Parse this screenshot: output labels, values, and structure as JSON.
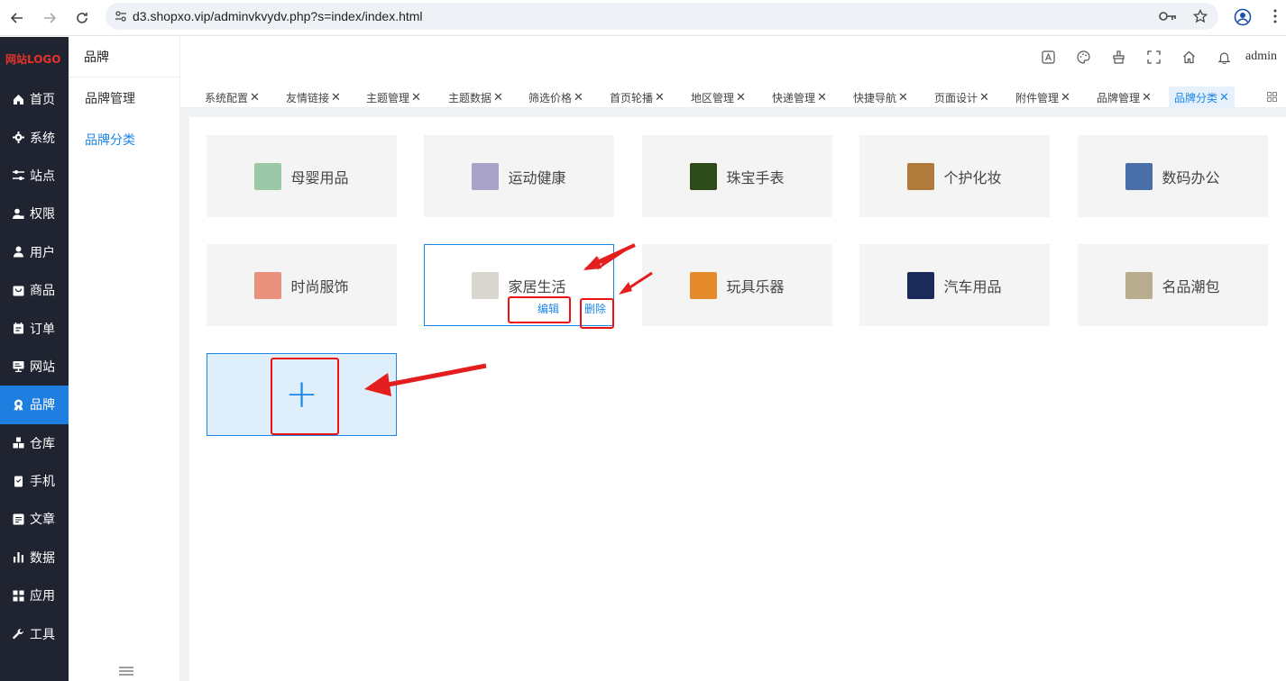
{
  "browser": {
    "url": "d3.shopxo.vip/adminvkvydv.php?s=index/index.html"
  },
  "sidebar": {
    "logo": "网站LOGO",
    "items": [
      {
        "label": "首页",
        "icon": "home-icon"
      },
      {
        "label": "系统",
        "icon": "gear-icon"
      },
      {
        "label": "站点",
        "icon": "sliders-icon"
      },
      {
        "label": "权限",
        "icon": "user-lock-icon"
      },
      {
        "label": "用户",
        "icon": "users-icon"
      },
      {
        "label": "商品",
        "icon": "bag-icon"
      },
      {
        "label": "订单",
        "icon": "order-icon"
      },
      {
        "label": "网站",
        "icon": "monitor-icon"
      },
      {
        "label": "品牌",
        "icon": "brand-icon",
        "active": true
      },
      {
        "label": "仓库",
        "icon": "warehouse-icon"
      },
      {
        "label": "手机",
        "icon": "phone-icon"
      },
      {
        "label": "文章",
        "icon": "article-icon"
      },
      {
        "label": "数据",
        "icon": "chart-icon"
      },
      {
        "label": "应用",
        "icon": "apps-icon"
      },
      {
        "label": "工具",
        "icon": "wrench-icon"
      }
    ]
  },
  "subnav": {
    "title": "品牌",
    "items": [
      {
        "label": "品牌管理"
      },
      {
        "label": "品牌分类",
        "active": true
      }
    ]
  },
  "header": {
    "user": "admin"
  },
  "tabs": [
    {
      "label": "系统配置"
    },
    {
      "label": "友情链接"
    },
    {
      "label": "主题管理"
    },
    {
      "label": "主题数据"
    },
    {
      "label": "筛选价格"
    },
    {
      "label": "首页轮播"
    },
    {
      "label": "地区管理"
    },
    {
      "label": "快递管理"
    },
    {
      "label": "快捷导航"
    },
    {
      "label": "页面设计"
    },
    {
      "label": "附件管理"
    },
    {
      "label": "品牌管理"
    },
    {
      "label": "品牌分类",
      "active": true
    }
  ],
  "categories": [
    {
      "label": "母婴用品",
      "color": "#9cc7a8"
    },
    {
      "label": "运动健康",
      "color": "#a9a3c9"
    },
    {
      "label": "珠宝手表",
      "color": "#2d4a1a"
    },
    {
      "label": "个护化妆",
      "color": "#b07a3a"
    },
    {
      "label": "数码办公",
      "color": "#4a6fa8"
    },
    {
      "label": "时尚服饰",
      "color": "#e8917c"
    },
    {
      "label": "家居生活",
      "color": "#d9d6d0"
    },
    {
      "label": "玩具乐器",
      "color": "#e58a2a"
    },
    {
      "label": "汽车用品",
      "color": "#1c2a5a"
    },
    {
      "label": "名品潮包",
      "color": "#b8ad8e"
    }
  ],
  "card_actions": {
    "edit": "编辑",
    "delete": "删除"
  },
  "add_button": "+"
}
